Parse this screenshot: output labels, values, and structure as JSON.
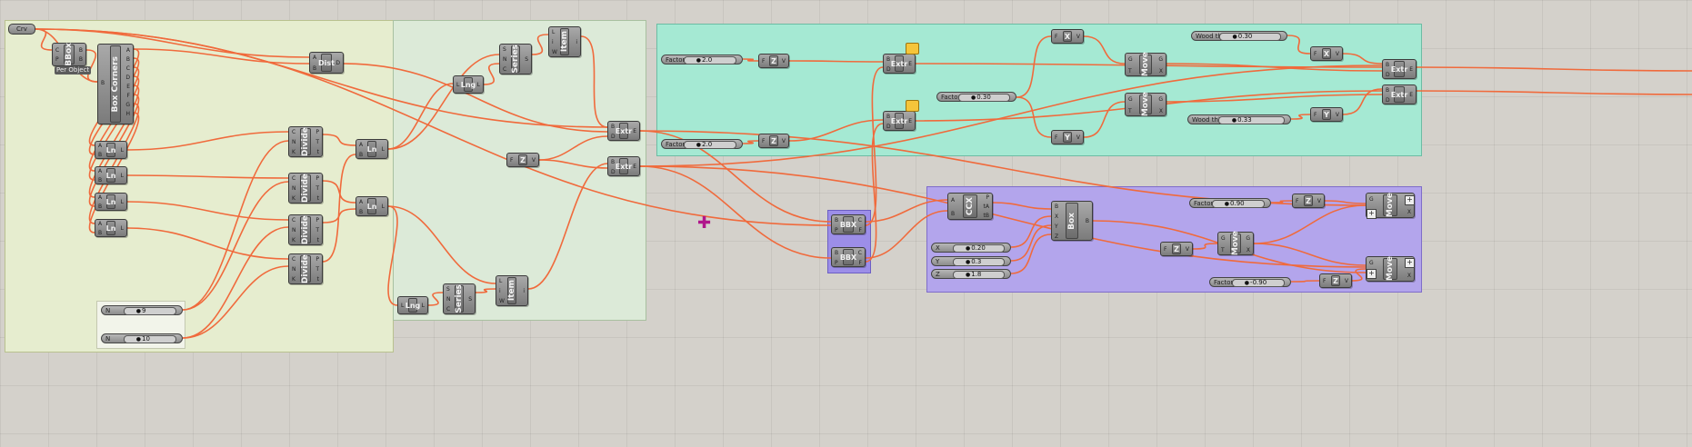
{
  "canvas": {
    "background": "#d4d1cb"
  },
  "wire_color": "#f06a3c",
  "components": [
    {
      "id": "crv",
      "name": "Crv",
      "kind": "param"
    },
    {
      "id": "bbox",
      "name": "BBox",
      "caption": "Per Object",
      "inputs": [
        "C",
        "P"
      ],
      "outputs": [
        "B",
        "B"
      ]
    },
    {
      "id": "boxcorners",
      "name": "Box Corners",
      "inputs": [
        "B"
      ],
      "outputs": [
        "A",
        "B",
        "C",
        "D",
        "E",
        "F",
        "G",
        "H"
      ]
    },
    {
      "id": "ln1",
      "name": "Ln",
      "inputs": [
        "A",
        "B"
      ],
      "outputs": [
        "L"
      ]
    },
    {
      "id": "ln2",
      "name": "Ln",
      "inputs": [
        "A",
        "B"
      ],
      "outputs": [
        "L"
      ]
    },
    {
      "id": "ln3",
      "name": "Ln",
      "inputs": [
        "A",
        "B"
      ],
      "outputs": [
        "L"
      ]
    },
    {
      "id": "ln4",
      "name": "Ln",
      "inputs": [
        "A",
        "B"
      ],
      "outputs": [
        "L"
      ]
    },
    {
      "id": "dist",
      "name": "Dist",
      "inputs": [
        "A",
        "B"
      ],
      "outputs": [
        "D"
      ]
    },
    {
      "id": "divide1",
      "name": "Divide",
      "inputs": [
        "C",
        "N",
        "K"
      ],
      "outputs": [
        "P",
        "T",
        "t"
      ]
    },
    {
      "id": "divide2",
      "name": "Divide",
      "inputs": [
        "C",
        "N",
        "K"
      ],
      "outputs": [
        "P",
        "T",
        "t"
      ]
    },
    {
      "id": "divide3",
      "name": "Divide",
      "inputs": [
        "C",
        "N",
        "K"
      ],
      "outputs": [
        "P",
        "T",
        "t"
      ]
    },
    {
      "id": "divide4",
      "name": "Divide",
      "inputs": [
        "C",
        "N",
        "K"
      ],
      "outputs": [
        "P",
        "T",
        "t"
      ]
    },
    {
      "id": "ln5",
      "name": "Ln",
      "inputs": [
        "A",
        "B"
      ],
      "outputs": [
        "L"
      ]
    },
    {
      "id": "ln6",
      "name": "Ln",
      "inputs": [
        "A",
        "B"
      ],
      "outputs": [
        "L"
      ]
    },
    {
      "id": "lng1",
      "name": "Lng",
      "inputs": [
        "L"
      ],
      "outputs": [
        "L"
      ]
    },
    {
      "id": "series1",
      "name": "Series",
      "inputs": [
        "S",
        "N",
        "C"
      ],
      "outputs": [
        "S"
      ]
    },
    {
      "id": "item1",
      "name": "Item",
      "inputs": [
        "L",
        "i",
        "W"
      ],
      "outputs": [
        "i"
      ]
    },
    {
      "id": "z1",
      "name": "Z",
      "inputs": [
        "F"
      ],
      "outputs": [
        "V"
      ]
    },
    {
      "id": "extr1",
      "name": "Extr",
      "inputs": [
        "B",
        "D"
      ],
      "outputs": [
        "E"
      ]
    },
    {
      "id": "extr2",
      "name": "Extr",
      "inputs": [
        "B",
        "D"
      ],
      "outputs": [
        "E"
      ]
    },
    {
      "id": "lng2",
      "name": "Lng",
      "inputs": [
        "L"
      ],
      "outputs": [
        "L"
      ]
    },
    {
      "id": "series2",
      "name": "Series",
      "inputs": [
        "S",
        "N",
        "C"
      ],
      "outputs": [
        "S"
      ]
    },
    {
      "id": "item2",
      "name": "Item",
      "inputs": [
        "L",
        "i",
        "W"
      ],
      "outputs": [
        "i"
      ]
    },
    {
      "id": "bbx1",
      "name": "BBX",
      "inputs": [
        "B",
        "P"
      ],
      "outputs": [
        "C",
        "F"
      ]
    },
    {
      "id": "bbx2",
      "name": "BBX",
      "inputs": [
        "B",
        "P"
      ],
      "outputs": [
        "C",
        "F"
      ]
    },
    {
      "id": "ccx",
      "name": "CCX",
      "inputs": [
        "A",
        "B"
      ],
      "outputs": [
        "P",
        "tA",
        "tB"
      ]
    },
    {
      "id": "box",
      "name": "Box",
      "inputs": [
        "B",
        "X",
        "Y",
        "Z"
      ],
      "outputs": [
        "B"
      ]
    },
    {
      "id": "z2",
      "name": "Z",
      "inputs": [
        "F"
      ],
      "outputs": [
        "V"
      ]
    },
    {
      "id": "z3",
      "name": "Z",
      "inputs": [
        "F"
      ],
      "outputs": [
        "V"
      ]
    },
    {
      "id": "extr3",
      "name": "Extr",
      "inputs": [
        "B",
        "D"
      ],
      "outputs": [
        "E"
      ]
    },
    {
      "id": "extr4",
      "name": "Extr",
      "inputs": [
        "B",
        "D"
      ],
      "outputs": [
        "E"
      ]
    },
    {
      "id": "x1",
      "name": "X",
      "inputs": [
        "F"
      ],
      "outputs": [
        "V"
      ]
    },
    {
      "id": "y1",
      "name": "Y",
      "inputs": [
        "F"
      ],
      "outputs": [
        "V"
      ]
    },
    {
      "id": "move1",
      "name": "Move",
      "inputs": [
        "G",
        "T"
      ],
      "outputs": [
        "G",
        "X"
      ]
    },
    {
      "id": "move2",
      "name": "Move",
      "inputs": [
        "G",
        "T"
      ],
      "outputs": [
        "G",
        "X"
      ]
    },
    {
      "id": "x2",
      "name": "X",
      "inputs": [
        "F"
      ],
      "outputs": [
        "V"
      ]
    },
    {
      "id": "y2",
      "name": "Y",
      "inputs": [
        "F"
      ],
      "outputs": [
        "V"
      ]
    },
    {
      "id": "extr5",
      "name": "Extr",
      "inputs": [
        "B",
        "D"
      ],
      "outputs": [
        "E"
      ]
    },
    {
      "id": "extr6",
      "name": "Extr",
      "inputs": [
        "B",
        "D"
      ],
      "outputs": [
        "E"
      ]
    },
    {
      "id": "z4",
      "name": "Z",
      "inputs": [
        "F"
      ],
      "outputs": [
        "V"
      ]
    },
    {
      "id": "move3",
      "name": "Move",
      "inputs": [
        "G",
        "T"
      ],
      "outputs": [
        "G",
        "X"
      ]
    },
    {
      "id": "z5",
      "name": "Z",
      "inputs": [
        "F"
      ],
      "outputs": [
        "V"
      ]
    },
    {
      "id": "move4",
      "name": "Move",
      "inputs": [
        "G",
        "T"
      ],
      "outputs": [
        "G",
        "X"
      ]
    },
    {
      "id": "z6",
      "name": "Z",
      "inputs": [
        "F"
      ],
      "outputs": [
        "V"
      ]
    },
    {
      "id": "move5",
      "name": "Move",
      "inputs": [
        "G",
        "T"
      ],
      "outputs": [
        "G",
        "X"
      ]
    }
  ],
  "sliders": [
    {
      "id": "s_n1",
      "label": "N",
      "value": "9"
    },
    {
      "id": "s_n2",
      "label": "N",
      "value": "10"
    },
    {
      "id": "s_factor1",
      "label": "Factor",
      "value": "2.0"
    },
    {
      "id": "s_factor2",
      "label": "Factor",
      "value": "2.0"
    },
    {
      "id": "s_factor3",
      "label": "Factor",
      "value": "0.30"
    },
    {
      "id": "s_wood_thick",
      "label": "Wood thickn",
      "value": "0.30"
    },
    {
      "id": "s_wood_thick2",
      "label": "Wood thickness",
      "value": "0.33"
    },
    {
      "id": "s_x",
      "label": "X",
      "value": "0.20"
    },
    {
      "id": "s_y",
      "label": "Y",
      "value": "0.3"
    },
    {
      "id": "s_z",
      "label": "Z",
      "value": "1.8"
    },
    {
      "id": "s_factor4",
      "label": "Factor",
      "value": "0.90"
    },
    {
      "id": "s_factor5",
      "label": "Factor",
      "value": "-0.90"
    }
  ]
}
